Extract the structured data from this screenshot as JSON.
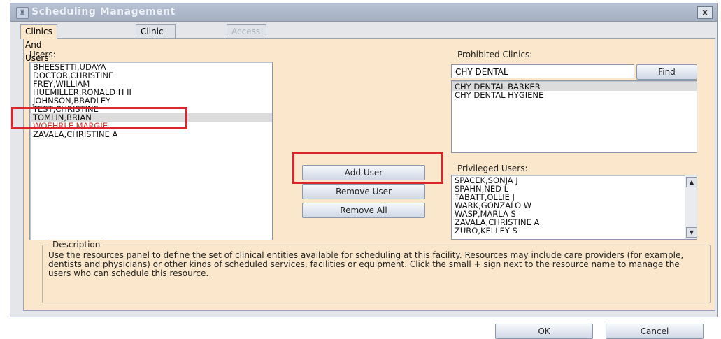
{
  "window": {
    "title": "Scheduling Management",
    "close_label": "x"
  },
  "tabs": [
    {
      "label": "Clinics And Users",
      "state": "active"
    },
    {
      "label": "Clinic Groups",
      "state": "normal"
    },
    {
      "label": "Access Groups",
      "state": "disabled"
    }
  ],
  "users": {
    "label": "Users:",
    "items": [
      "BHEESETTI,UDAYA",
      "DOCTOR,CHRISTINE",
      "FREY,WILLIAM",
      "HUEMILLER,RONALD H II",
      "JOHNSON,BRADLEY",
      "TEST,CHRISTINE",
      "TOMLIN,BRIAN",
      "WOEHRLE,MARGIE",
      "ZAVALA,CHRISTINE A"
    ],
    "selected_index": 6
  },
  "buttons": {
    "add_user": "Add User",
    "remove_user": "Remove User",
    "remove_all": "Remove All"
  },
  "prohibited_clinics": {
    "label": "Prohibited Clinics:",
    "search_value": "CHY DENTAL",
    "find_label": "Find",
    "items": [
      "CHY DENTAL BARKER",
      "CHY DENTAL HYGIENE"
    ],
    "selected_index": 0
  },
  "privileged_users": {
    "label": "Privileged Users:",
    "items": [
      "SPACEK,SONJA J",
      "SPAHN,NED L",
      "TABATT,OLLIE J",
      "WARK,GONZALO W",
      "WASP,MARLA S",
      "ZAVALA,CHRISTINE A",
      "ZURO,KELLEY S"
    ]
  },
  "description": {
    "legend": "Description",
    "text": "Use the resources panel to define the set of clinical entities available for scheduling at this facility. Resources may include care providers (for example, dentists and physicians) or other kinds of scheduled services, facilities or equipment.  Click the small + sign next to the resource name to manage the users who can schedule this resource."
  },
  "footer": {
    "ok_label": "OK",
    "cancel_label": "Cancel"
  },
  "colors": {
    "panel_bg": "#fbe8cc",
    "highlight_box": "#d9262b"
  }
}
